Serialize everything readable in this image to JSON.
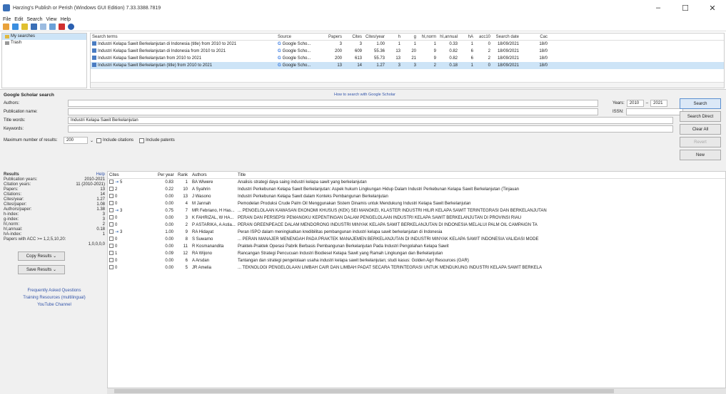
{
  "window": {
    "title": "Harzing's Publish or Perish (Windows GUI Edition) 7.33.3388.7819",
    "min": "–",
    "max": "☐",
    "close": "✕"
  },
  "menu": [
    "File",
    "Edit",
    "Search",
    "View",
    "Help"
  ],
  "tree": {
    "items": [
      {
        "label": "My searches",
        "selected": true
      },
      {
        "label": "Trash",
        "selected": false
      }
    ]
  },
  "queries": {
    "columns": [
      "Search terms",
      "Source",
      "Papers",
      "Cites",
      "Cites/year",
      "h",
      "g",
      "hI,norm",
      "hI,annual",
      "hA",
      "acc10",
      "Search date",
      "Cac"
    ],
    "rows": [
      {
        "terms": "Industri Kelapa Sawit Berkelanjutan di Indonesia (title) from 2010 to 2021",
        "source": "Google Scho...",
        "papers": "3",
        "cites": "3",
        "cpy": "1.00",
        "h": "1",
        "g": "1",
        "hin": "1",
        "hia": "0.33",
        "ha": "1",
        "acc": "0",
        "date": "18/09/2021",
        "cac": "18/0"
      },
      {
        "terms": "Industri Kelapa Sawit Berkelanjutan di Indonesia from 2010 to 2021",
        "source": "Google Scho...",
        "papers": "200",
        "cites": "609",
        "cpy": "55.36",
        "h": "13",
        "g": "20",
        "hin": "9",
        "hia": "0.82",
        "ha": "6",
        "acc": "2",
        "date": "18/09/2021",
        "cac": "18/0"
      },
      {
        "terms": "Industri Kelapa Sawit Berkelanjutan from 2010 to 2021",
        "source": "Google Scho...",
        "papers": "200",
        "cites": "613",
        "cpy": "55.73",
        "h": "13",
        "g": "21",
        "hin": "9",
        "hia": "0.82",
        "ha": "6",
        "acc": "2",
        "date": "18/09/2021",
        "cac": "18/0"
      },
      {
        "terms": "Industri Kelapa Sawit Berkelanjutan (title) from 2010 to 2021",
        "source": "Google Scho...",
        "papers": "13",
        "cites": "14",
        "cpy": "1.27",
        "h": "3",
        "g": "3",
        "hin": "2",
        "hia": "0.18",
        "ha": "1",
        "acc": "0",
        "date": "18/09/2021",
        "cac": "18/0"
      }
    ]
  },
  "search": {
    "title": "Google Scholar search",
    "help": "How to search with Google Scholar",
    "authors_label": "Authors:",
    "pub_label": "Publication name:",
    "title_label": "Title words:",
    "keywords_label": "Keywords:",
    "title_value": "Industri Kelapa Sawit Berkelanjutan",
    "years_label": "Years:",
    "year_from": "2010",
    "year_dash": "–",
    "year_to": "2021",
    "issn_label": "ISSN:",
    "max_label": "Maximum number of results:",
    "max_value": "200",
    "incl_citations": "Include citations",
    "incl_patents": "Include patents",
    "btn_search": "Search",
    "btn_search_direct": "Search Direct",
    "btn_clear": "Clear All",
    "btn_revert": "Revert",
    "btn_new": "New"
  },
  "stats": {
    "title": "Results",
    "help": "Help",
    "rows": [
      [
        "Publication years:",
        "2010-2021"
      ],
      [
        "Citation years:",
        "11 (2010-2021)"
      ],
      [
        "Papers:",
        "13"
      ],
      [
        "Citations:",
        "14"
      ],
      [
        "Cites/year:",
        "1.27"
      ],
      [
        "Cites/paper:",
        "1.08"
      ],
      [
        "Authors/paper:",
        "1.38"
      ],
      [
        "h-index:",
        "3"
      ],
      [
        "g-index:",
        "3"
      ],
      [
        "hI,norm:",
        "2"
      ],
      [
        "hI,annual:",
        "0.18"
      ],
      [
        "hA-index:",
        "1"
      ],
      [
        "Papers with ACC >= 1,2,5,10,20:",
        ""
      ],
      [
        "",
        "1,0,0,0,0"
      ]
    ],
    "copy": "Copy Results",
    "save": "Save Results",
    "links": [
      "Frequently Asked Questions",
      "Training Resources (multilingual)",
      "YouTube Channel"
    ]
  },
  "results": {
    "columns": [
      "Cites",
      "Per year",
      "Rank",
      "Authors",
      "Title"
    ],
    "rows": [
      {
        "cites": "5",
        "py": "0.83",
        "rank": "1",
        "auth": "BA Wiwere",
        "title": "Analisis strategi daya saing industri kelapa sawit yang berkelanjutan"
      },
      {
        "cites": "2",
        "py": "0.22",
        "rank": "10",
        "auth": "A Syahrin",
        "title": "Industri Perkebunan Kelapa Sawit Berkelanjutan: Aspek hukum Lingkungan Hidup Dalam Industri Perkebunan Kelapa Sawit Berkelanjutan (Tinjauan"
      },
      {
        "cites": "0",
        "py": "0.00",
        "rank": "13",
        "auth": "J Wasono",
        "title": "Industri Perkebunan Kelapa Sawit dalam Konteks Pembangunan Berkelanjutan"
      },
      {
        "cites": "0",
        "py": "0.00",
        "rank": "4",
        "auth": "M Jannah",
        "title": "Pemodelan Produksi Crude Palm Oil Menggunakan Sistem Dinamis untuk Mendukung Industri Kelapa Sawit Berkelanjutan"
      },
      {
        "cites": "3",
        "py": "0.75",
        "rank": "7",
        "auth": "MR Febriano, H Has...",
        "title": "... PENGELOLAAN KAWASAN EKONOMI KHUSUS (KEK) SEI MANGKEI, KLASTER INDUSTRI HILIR KELAPA SAWIT TERINTEGRASI DAN BERKELANJUTAN"
      },
      {
        "cites": "0",
        "py": "0.00",
        "rank": "3",
        "auth": "K FAHRIZAL, W HA...",
        "title": "PERAN DAN PERSEPSI PEMANGKU KEPENTINGAN DALAM PENGELOLAAN INDUSTRI KELAPA SAWIT BERKELANJUTAN DI PROVINSI RIAU"
      },
      {
        "cites": "0",
        "py": "0.00",
        "rank": "2",
        "auth": "P ASTARIKA, A Astia...",
        "title": "PERAN GREENPEACE DALAM MENDORONG INDUSTRI MINYAK KELAPA SAWIT BERKELANJUTAN DI INDONESIA MELALUI PALM OIL CAMPAIGN TA"
      },
      {
        "cites": "3",
        "py": "1.00",
        "rank": "9",
        "auth": "RA Hidayat",
        "title": "Peran ISPO dalam meningkatkan kredibilitas pembangunan industri kelapa sawit berkelanjutan di Indonesia"
      },
      {
        "cites": "0",
        "py": "0.00",
        "rank": "8",
        "auth": "S Suwarno",
        "title": "... PERAN MANAJER MENENGAH PADA PRAKTEK MANAJEMEN BERKELANJUTAN DI INDUSTRI MINYAK KELAPA SAWIT INDONESIA VALIDASI MODE"
      },
      {
        "cites": "0",
        "py": "0.00",
        "rank": "11",
        "auth": "R Kosmanandita",
        "title": "Praktek-Praktek Operasi Pabrik Berbasis Pembangunan Berkelanjutan Pada Industri Pengolahan Kelapa Sawit"
      },
      {
        "cites": "1",
        "py": "0.09",
        "rank": "12",
        "auth": "RA Wijono",
        "title": "Rancangan Strategi Pencucuan Industri Biodiesel Kelapa Sawit yang Ramah Lingkungan dan Berkelanjutan"
      },
      {
        "cites": "0",
        "py": "0.00",
        "rank": "6",
        "auth": "A Arsdan",
        "title": "Tantangan dan strategi pengelolaan usaha industri kelapa sawit berkelanjutan; studi kasus: Golden Agri Resources (GAR)"
      },
      {
        "cites": "0",
        "py": "0.00",
        "rank": "5",
        "auth": "JR Amelia",
        "title": "... TEKNOLOGI PENGELOLAAN LIMBAH CAIR DAN LIMBAH PADAT SECARA TERINTEGRASI UNTUK MENDUKUNG INDUSTRI KELAPA SAWIT BERKELA"
      }
    ]
  }
}
